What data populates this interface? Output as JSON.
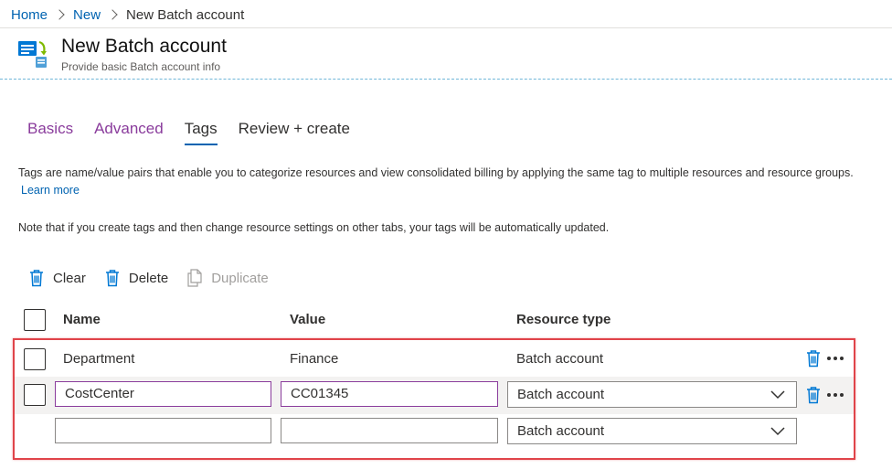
{
  "breadcrumb": {
    "home": "Home",
    "new": "New",
    "current": "New Batch account"
  },
  "header": {
    "title": "New Batch account",
    "subtitle": "Provide basic Batch account info",
    "icon": "batch-account-icon"
  },
  "tabs": [
    {
      "label": "Basics"
    },
    {
      "label": "Advanced"
    },
    {
      "label": "Tags"
    },
    {
      "label": "Review + create"
    }
  ],
  "description": {
    "text": "Tags are name/value pairs that enable you to categorize resources and view consolidated billing by applying the same tag to multiple resources and resource groups.",
    "link": "Learn more"
  },
  "note": "Note that if you create tags and then change resource settings on other tabs, your tags will be automatically updated.",
  "toolbar": {
    "clear": "Clear",
    "delete": "Delete",
    "duplicate": "Duplicate"
  },
  "columns": {
    "name": "Name",
    "value": "Value",
    "resource_type": "Resource type"
  },
  "rows": [
    {
      "name": "Department",
      "value": "Finance",
      "resource_type": "Batch account"
    },
    {
      "name": "CostCenter",
      "value": "CC01345",
      "resource_type": "Batch account"
    },
    {
      "name": "",
      "value": "",
      "resource_type": "Batch account"
    }
  ],
  "colors": {
    "accent": "#0063b1",
    "tab_link": "#8a3c9c",
    "highlight": "#e0444a",
    "icon_blue": "#0078d4"
  }
}
